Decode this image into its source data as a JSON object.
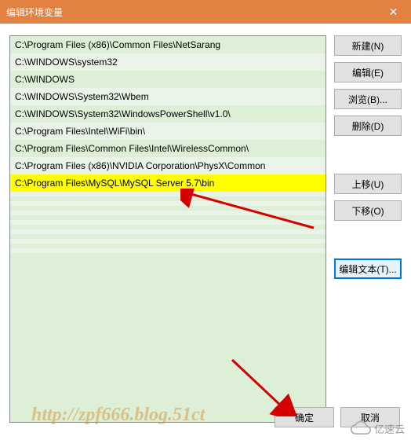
{
  "window": {
    "title": "编辑环境变量"
  },
  "paths": [
    "C:\\Program Files (x86)\\Common Files\\NetSarang",
    "C:\\WINDOWS\\system32",
    "C:\\WINDOWS",
    "C:\\WINDOWS\\System32\\Wbem",
    "C:\\WINDOWS\\System32\\WindowsPowerShell\\v1.0\\",
    "C:\\Program Files\\Intel\\WiFi\\bin\\",
    "C:\\Program Files\\Common Files\\Intel\\WirelessCommon\\",
    "C:\\Program Files (x86)\\NVIDIA Corporation\\PhysX\\Common",
    "C:\\Program Files\\MySQL\\MySQL Server 5.7\\bin"
  ],
  "highlighted_index": 8,
  "buttons": {
    "new": "新建(N)",
    "edit": "编辑(E)",
    "browse": "浏览(B)...",
    "delete": "删除(D)",
    "moveup": "上移(U)",
    "movedown": "下移(O)",
    "edittext": "编辑文本(T)...",
    "ok": "确定",
    "cancel": "取消"
  },
  "watermark": {
    "url": "http://zpf666.blog.51ct",
    "brand": "亿速云"
  }
}
